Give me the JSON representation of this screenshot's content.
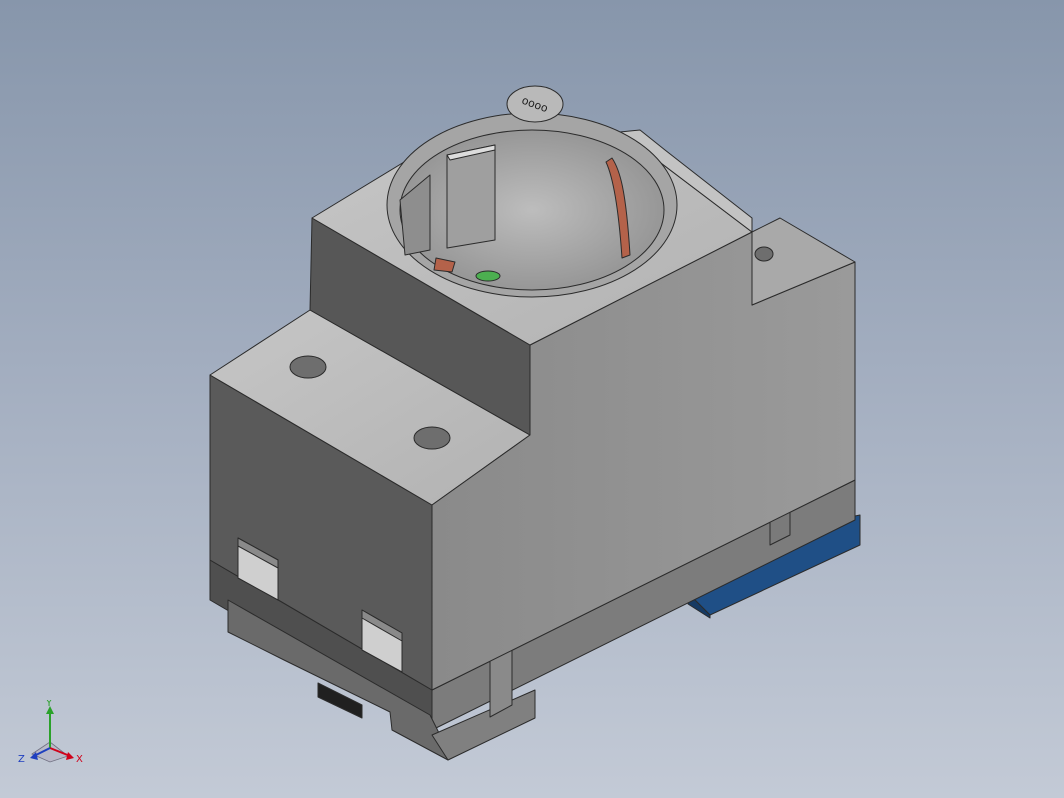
{
  "viewport": {
    "background_top": "#8796ab",
    "background_bottom": "#c3cad6"
  },
  "model": {
    "body_colors": {
      "top": "#bdbdbd",
      "left": "#5a5a5a",
      "right": "#8e8e8e",
      "edge": "#2b2b2b"
    },
    "contact_color": "#b4624a",
    "din_clip_color": "#1f4f86",
    "logo_icon": "brand-logo-icon"
  },
  "triad": {
    "x_label": "X",
    "y_label": "Y",
    "z_label": "Z",
    "x_color": "#d0021b",
    "y_color": "#2aa12a",
    "z_color": "#1f3fbf"
  }
}
